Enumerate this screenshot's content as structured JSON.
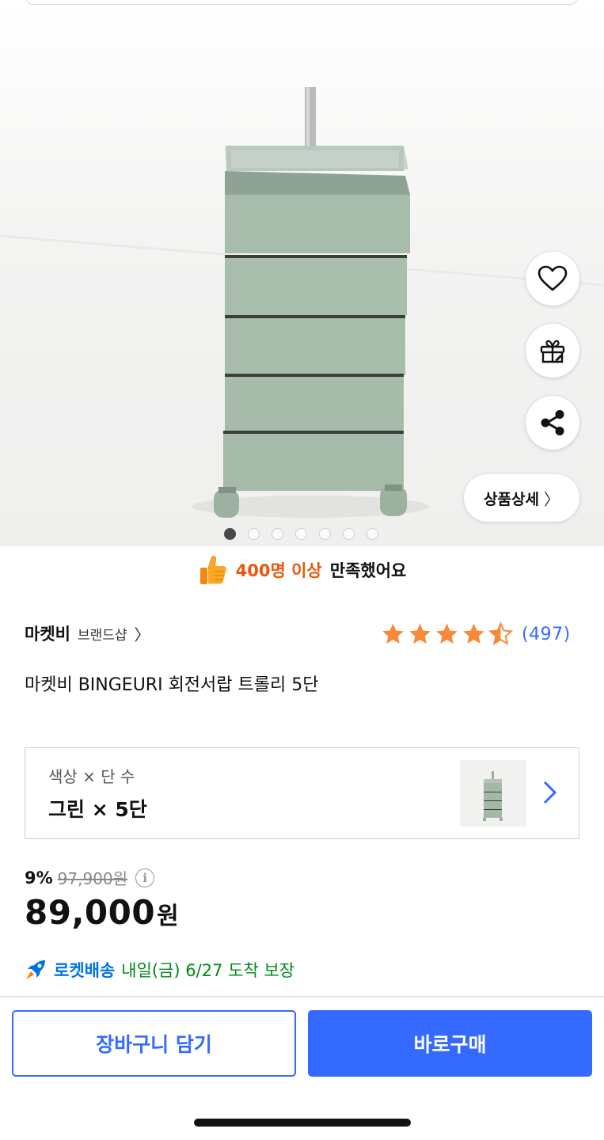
{
  "hero": {
    "image_alt": "",
    "dots_total": 7,
    "dots_active_index": 0,
    "detail_button_label": "상품상세",
    "icons": [
      "heart-icon",
      "gift-icon",
      "share-icon"
    ]
  },
  "satisfaction": {
    "highlight": "400명 이상",
    "rest": "만족했어요"
  },
  "brand": {
    "name": "마켓비",
    "shop_label": "브랜드샵"
  },
  "rating": {
    "stars": 4.5,
    "count": "(497)"
  },
  "product": {
    "title": "마켓비 BINGEURI 회전서랍 트롤리 5단"
  },
  "option": {
    "label": "색상 × 단 수",
    "value": "그린 × 5단"
  },
  "price": {
    "discount": "9%",
    "original": "97,900원",
    "sale_number": "89,000",
    "sale_unit": "원"
  },
  "delivery": {
    "badge": "로켓배송",
    "text": "내일(금) 6/27 도착 보장"
  },
  "actions": {
    "cart": "장바구니 담기",
    "buy": "바로구매"
  },
  "colors": {
    "accent": "#346aff",
    "orange": "#e8590c",
    "rocket_blue": "#0073e9",
    "delivery_green": "#00891a",
    "star": "#f7893a"
  }
}
